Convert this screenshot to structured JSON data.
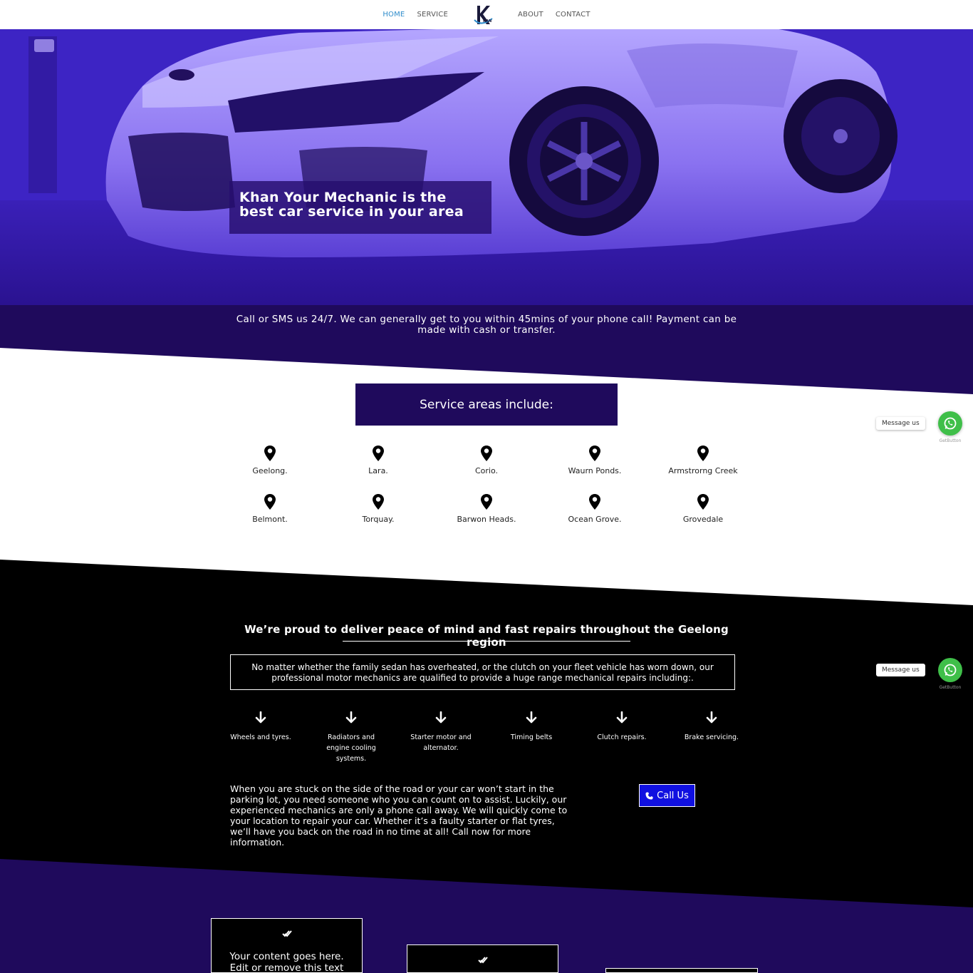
{
  "nav": {
    "items": [
      {
        "label": "HOME",
        "active": true
      },
      {
        "label": "SERVICE",
        "active": false
      },
      {
        "label": "ABOUT",
        "active": false
      },
      {
        "label": "CONTACT",
        "active": false
      }
    ],
    "logo_icon": "khan-logo"
  },
  "hero": {
    "headline_line1": "Khan Your Mechanic is the",
    "headline_line2": "best car service in your area",
    "tagline": "Call or SMS us 24/7. We can generally get to you within 45mins of your phone call! Payment can be made with cash or transfer."
  },
  "areas": {
    "title": "Service areas include:",
    "icon": "map-pin-icon",
    "items": [
      "Geelong.",
      "Lara.",
      "Corio.",
      "Waurn Ponds.",
      "Armstrorng Creek",
      "Belmont.",
      "Torquay.",
      "Barwon Heads.",
      "Ocean Grove.",
      "Grovedale"
    ]
  },
  "repairs": {
    "heading": "We’re proud to deliver peace of mind and fast repairs throughout the Geelong region",
    "intro": "No matter whether the family sedan has overheated, or the clutch on your fleet vehicle has worn down, our professional motor mechanics are qualified to provide a huge range mechanical repairs including:.",
    "icon": "arrow-down-icon",
    "services": [
      "Wheels and tyres.",
      "Radiators and engine cooling systems.",
      "Starter motor and alternator.",
      "Timing belts",
      "Clutch repairs.",
      "Brake servicing."
    ],
    "paragraph": "When you are stuck on the side of the road or your car won’t start in the parking lot, you need someone who you can count on to assist. Luckily, our experienced mechanics are only a phone call away. We will quickly come to your location to repair your car. Whether it’s a faulty starter or flat tyres, we’ll have you back on the road in no time at all! Call now for more information.",
    "call_label": "Call Us",
    "call_icon": "phone-icon"
  },
  "cards": {
    "icon": "double-check-icon",
    "text": "Your content goes here. Edit or remove this text inline or"
  },
  "whatsapp": {
    "label": "Message us",
    "sub": "GetButton",
    "color": "#3fbf49"
  },
  "colors": {
    "deep_purple": "#1f0a5c",
    "hero_purple": "#4a2bd9",
    "call_blue": "#1010e0",
    "nav_active": "#2e8ccb"
  }
}
